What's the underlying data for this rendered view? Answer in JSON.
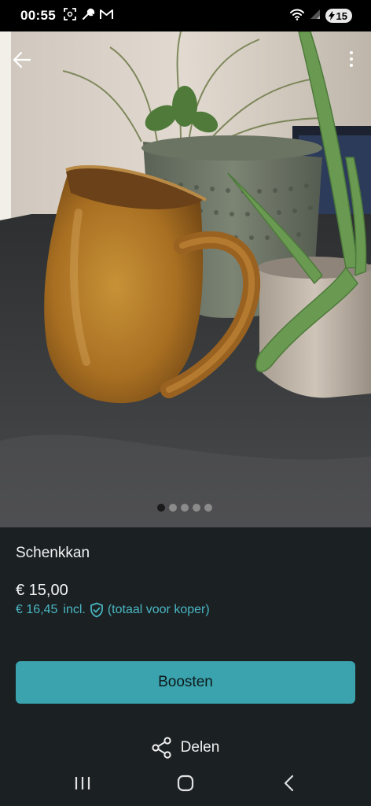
{
  "status_bar": {
    "time": "00:55",
    "battery_level": "15",
    "icons_left": [
      "screenshot-icon",
      "wrench-icon",
      "gmail-icon"
    ],
    "icons_right": [
      "wifi-icon",
      "signal-icon",
      "battery-icon"
    ]
  },
  "photo": {
    "slide_count": 5,
    "active_slide": 1
  },
  "listing": {
    "title": "Schenkkan",
    "price": "€ 15,00",
    "total_price": "€ 16,45",
    "incl_label": "incl.",
    "total_note": "(totaal voor koper)"
  },
  "actions": {
    "boost_label": "Boosten",
    "share_label": "Delen"
  },
  "colors": {
    "accent": "#3aa3ad",
    "accent_text": "#49b6c2",
    "background": "#1b2123"
  }
}
